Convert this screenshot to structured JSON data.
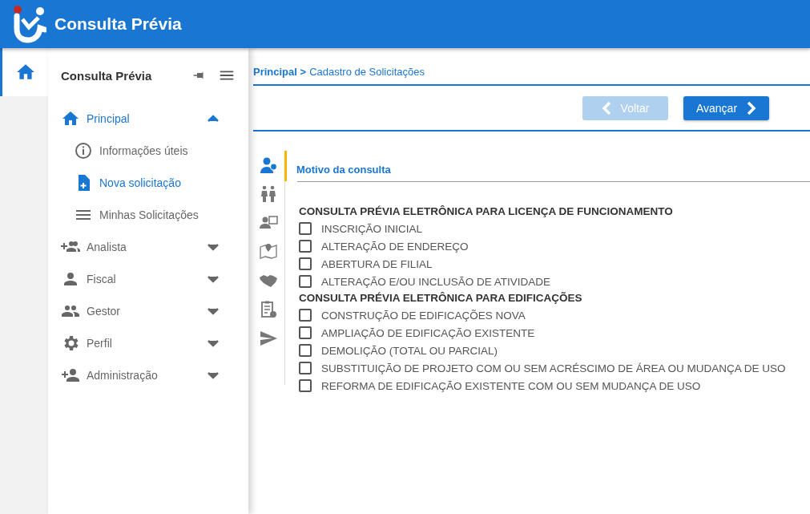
{
  "header": {
    "title": "Consulta Prévia"
  },
  "rail": {
    "items": [
      {
        "selected": true
      }
    ]
  },
  "sidebar": {
    "title": "Consulta Prévia",
    "items": [
      {
        "label": "Principal",
        "selected": true,
        "expanded": true,
        "children": [
          {
            "label": "Informações úteis",
            "selected": false
          },
          {
            "label": "Nova solicitação",
            "selected": true
          },
          {
            "label": "Minhas Solicitações",
            "selected": false
          }
        ]
      },
      {
        "label": "Analista",
        "selected": false,
        "expanded": false
      },
      {
        "label": "Fiscal",
        "selected": false,
        "expanded": false
      },
      {
        "label": "Gestor",
        "selected": false,
        "expanded": false
      },
      {
        "label": "Perfil",
        "selected": false,
        "expanded": false
      },
      {
        "label": "Administração",
        "selected": false,
        "expanded": false
      }
    ]
  },
  "breadcrumb": {
    "root": "Principal",
    "separator": ">",
    "current": "Cadastro de Solicitações"
  },
  "buttons": [
    {
      "label": "Voltar",
      "disabled": true
    },
    {
      "label": "Avançar",
      "disabled": false
    }
  ],
  "steps": [
    {
      "selected": true
    },
    {
      "selected": false
    },
    {
      "selected": false
    },
    {
      "selected": false
    },
    {
      "selected": false
    },
    {
      "selected": false
    },
    {
      "selected": false
    }
  ],
  "section": {
    "title": "Motivo da consulta",
    "groups": [
      {
        "heading": "CONSULTA PRÉVIA ELETRÔNICA PARA LICENÇA DE FUNCIONAMENTO",
        "options": [
          {
            "label": "INSCRIÇÃO INICIAL",
            "checked": false
          },
          {
            "label": "ALTERAÇÃO DE ENDEREÇO",
            "checked": false
          },
          {
            "label": "ABERTURA DE FILIAL",
            "checked": false
          },
          {
            "label": "ALTERAÇÃO E/OU INCLUSÃO DE ATIVIDADE",
            "checked": false
          }
        ]
      },
      {
        "heading": "CONSULTA PRÉVIA ELETRÔNICA PARA EDIFICAÇÕES",
        "options": [
          {
            "label": "CONSTRUÇÃO DE EDIFICAÇÕES NOVA",
            "checked": false
          },
          {
            "label": "AMPLIAÇÃO DE EDIFICAÇÃO EXISTENTE",
            "checked": false
          },
          {
            "label": "DEMOLIÇÃO (TOTAL OU PARCIAL)",
            "checked": false
          },
          {
            "label": "SUBSTITUIÇÃO DE PROJETO COM OU SEM ACRÉSCIMO DE ÁREA OU MUDANÇA DE USO",
            "checked": false
          },
          {
            "label": "REFORMA DE EDIFICAÇÃO EXISTENTE COM OU SEM MUDANÇA DE USO",
            "checked": false
          }
        ]
      }
    ]
  }
}
